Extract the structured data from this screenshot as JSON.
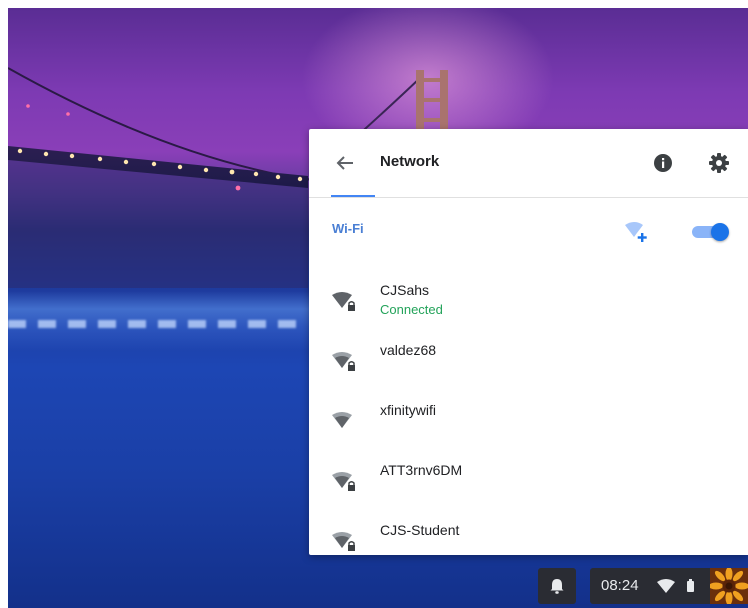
{
  "panel": {
    "title": "Network",
    "wifi_label": "Wi-Fi",
    "wifi_enabled": true
  },
  "networks": [
    {
      "name": "CJSahs",
      "status": "Connected",
      "secured": true
    },
    {
      "name": "valdez68",
      "status": "",
      "secured": true
    },
    {
      "name": "xfinitywifi",
      "status": "",
      "secured": false
    },
    {
      "name": "ATT3rnv6DM",
      "status": "",
      "secured": true
    },
    {
      "name": "CJS-Student",
      "status": "",
      "secured": true
    }
  ],
  "shelf": {
    "time": "08:24"
  },
  "colors": {
    "accent": "#4285f4",
    "connected": "#23a35a",
    "shelf": "#2a2c33"
  },
  "icons": {
    "back": "arrow-back-icon",
    "info": "info-icon",
    "settings": "gear-icon",
    "add_network": "wifi-add-icon",
    "notifications": "bell-icon",
    "wifi": "wifi-icon",
    "battery": "battery-icon"
  }
}
